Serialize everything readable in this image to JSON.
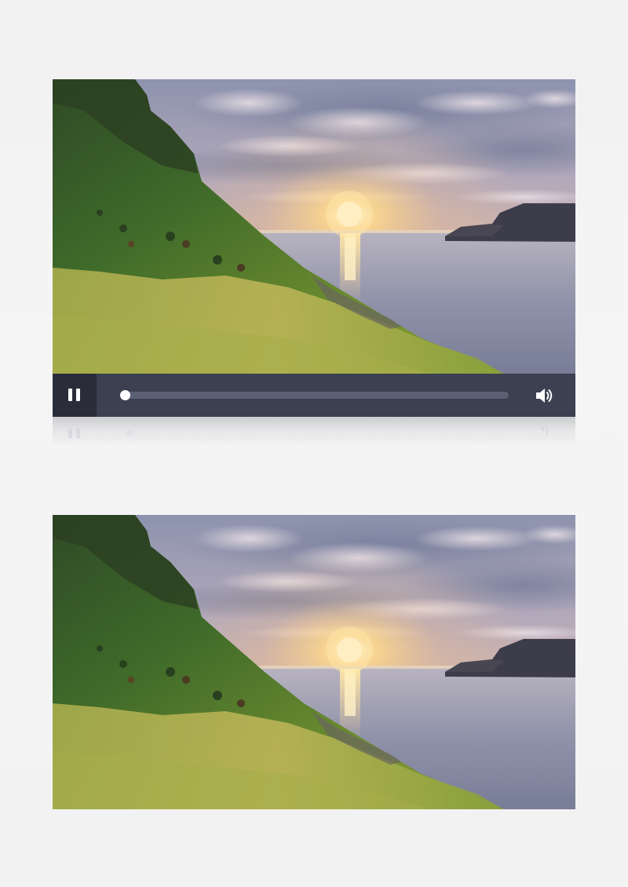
{
  "players": [
    {
      "state": "playing",
      "progress": 0.0,
      "controls_visible": true,
      "pause_icon": "pause-icon",
      "volume_icon": "volume-high-icon"
    },
    {
      "state": "paused",
      "controls_visible": false
    }
  ],
  "colors": {
    "control_bar": "#3c4050",
    "pause_button_bg": "#2a2d39",
    "seek_track": "#5b6073",
    "icon": "#ffffff",
    "page_background": "#f2f2f2"
  }
}
